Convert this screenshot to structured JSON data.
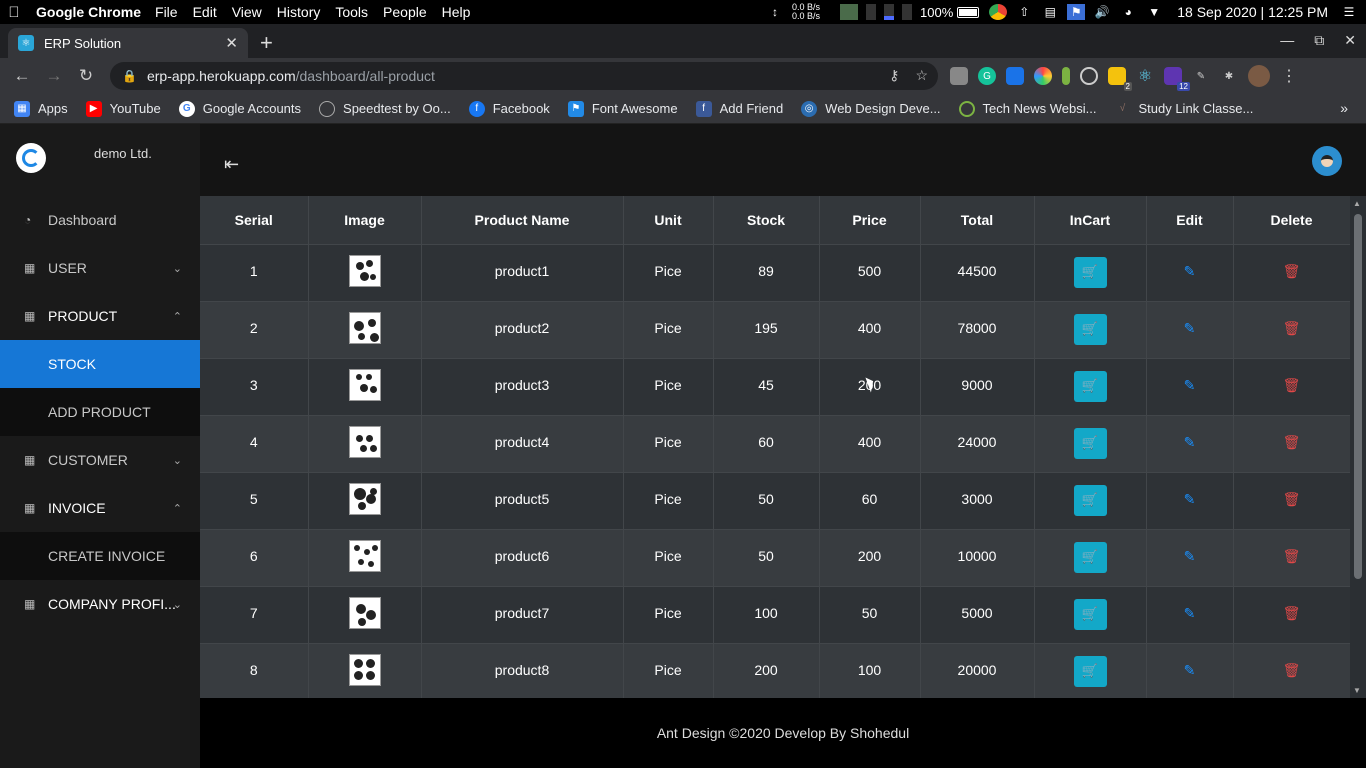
{
  "os_menubar": {
    "app_name": "Google Chrome",
    "menus": [
      "File",
      "Edit",
      "View",
      "History",
      "Tools",
      "People",
      "Help"
    ],
    "net_up": "0.0 B/s",
    "net_down": "0.0 B/s",
    "battery": "100%",
    "datetime": "18 Sep 2020 | 12:25 PM"
  },
  "browser": {
    "tab_title": "ERP Solution",
    "url_host": "erp-app.herokuapp.com",
    "url_path": "/dashboard/all-product",
    "extension_badges": [
      "2",
      "12"
    ],
    "bookmarks": [
      {
        "label": "Apps",
        "icon": "apps-grid-icon",
        "color": "#4285f4"
      },
      {
        "label": "YouTube",
        "icon": "youtube-icon",
        "color": "#ff0000"
      },
      {
        "label": "Google Accounts",
        "icon": "google-icon",
        "color": "#ffffff"
      },
      {
        "label": "Speedtest by Oo...",
        "icon": "speedtest-icon",
        "color": "#444444"
      },
      {
        "label": "Facebook",
        "icon": "facebook-icon",
        "color": "#1877f2"
      },
      {
        "label": "Font Awesome",
        "icon": "font-awesome-icon",
        "color": "#228ae6"
      },
      {
        "label": "Add Friend",
        "icon": "facebook-icon",
        "color": "#3b5998"
      },
      {
        "label": "Web Design Deve...",
        "icon": "web-design-icon",
        "color": "#2b6cb0"
      },
      {
        "label": "Tech News Websi...",
        "icon": "tech-news-icon",
        "color": "#7cb342"
      },
      {
        "label": "Study Link Classe...",
        "icon": "study-link-icon",
        "color": "#8d6e63"
      }
    ]
  },
  "app": {
    "company": "demo Ltd.",
    "sidebar": [
      {
        "label": "Dashboard",
        "icon": "dashboard-icon",
        "type": "item"
      },
      {
        "label": "USER",
        "icon": "grid-icon",
        "type": "group",
        "chevron": "down"
      },
      {
        "label": "PRODUCT",
        "icon": "grid-icon",
        "type": "group",
        "chevron": "up"
      },
      {
        "label": "STOCK",
        "type": "sub",
        "active": true
      },
      {
        "label": "ADD PRODUCT",
        "type": "sub"
      },
      {
        "label": "CUSTOMER",
        "icon": "grid-icon",
        "type": "group",
        "chevron": "down"
      },
      {
        "label": "INVOICE",
        "icon": "grid-icon",
        "type": "group",
        "chevron": "up"
      },
      {
        "label": "CREATE INVOICE",
        "type": "sub"
      },
      {
        "label": "COMPANY PROFI...",
        "icon": "grid-icon",
        "type": "group",
        "chevron": "down"
      }
    ],
    "table": {
      "columns": [
        "Serial",
        "Image",
        "Product Name",
        "Unit",
        "Stock",
        "Price",
        "Total",
        "InCart",
        "Edit",
        "Delete"
      ],
      "rows": [
        {
          "serial": "1",
          "name": "product1",
          "unit": "Pice",
          "stock": "89",
          "price": "500",
          "total": "44500"
        },
        {
          "serial": "2",
          "name": "product2",
          "unit": "Pice",
          "stock": "195",
          "price": "400",
          "total": "78000"
        },
        {
          "serial": "3",
          "name": "product3",
          "unit": "Pice",
          "stock": "45",
          "price": "200",
          "total": "9000"
        },
        {
          "serial": "4",
          "name": "product4",
          "unit": "Pice",
          "stock": "60",
          "price": "400",
          "total": "24000"
        },
        {
          "serial": "5",
          "name": "product5",
          "unit": "Pice",
          "stock": "50",
          "price": "60",
          "total": "3000"
        },
        {
          "serial": "6",
          "name": "product6",
          "unit": "Pice",
          "stock": "50",
          "price": "200",
          "total": "10000"
        },
        {
          "serial": "7",
          "name": "product7",
          "unit": "Pice",
          "stock": "100",
          "price": "50",
          "total": "5000"
        },
        {
          "serial": "8",
          "name": "product8",
          "unit": "Pice",
          "stock": "200",
          "price": "100",
          "total": "20000"
        }
      ]
    },
    "footer": "Ant Design ©2020 Develop By Shohedul",
    "colors": {
      "active_menu": "#1677d6",
      "cart_button": "#13a8c8",
      "edit": "#1890ff",
      "delete": "#e04848"
    }
  }
}
